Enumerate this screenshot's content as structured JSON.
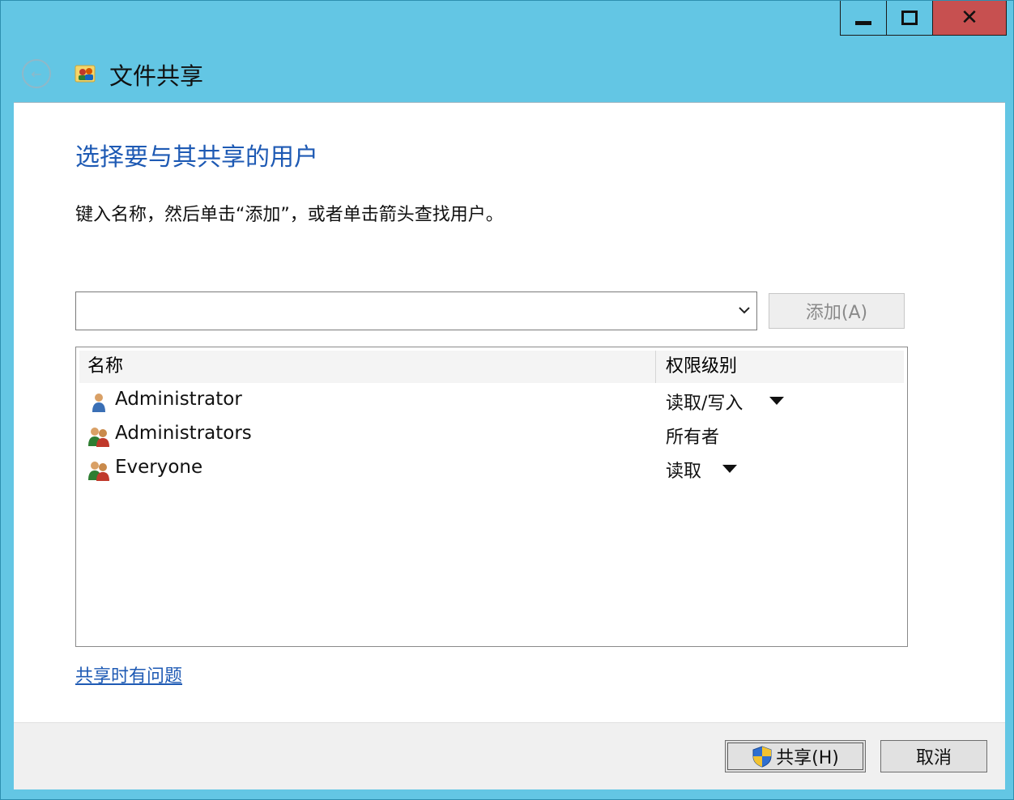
{
  "window": {
    "title": "文件共享",
    "controls": {
      "minimize": "minimize",
      "maximize": "maximize",
      "close": "close"
    }
  },
  "main": {
    "heading": "选择要与其共享的用户",
    "instruction": "键入名称，然后单击“添加”，或者单击箭头查找用户。",
    "name_input": {
      "value": "",
      "placeholder": ""
    },
    "add_button": "添加(A)",
    "table": {
      "columns": [
        "名称",
        "权限级别"
      ],
      "rows": [
        {
          "name": "Administrator",
          "permission": "读取/写入",
          "icon": "user-icon",
          "has_dropdown": true
        },
        {
          "name": "Administrators",
          "permission": "所有者",
          "icon": "group-icon",
          "has_dropdown": false
        },
        {
          "name": "Everyone",
          "permission": "读取",
          "icon": "group-icon",
          "has_dropdown": true
        }
      ]
    },
    "help_link": "共享时有问题"
  },
  "footer": {
    "share_button": "共享(H)",
    "cancel_button": "取消"
  },
  "colors": {
    "frame": "#63c6e4",
    "heading": "#1e5ab4",
    "close_button": "#c75050"
  }
}
